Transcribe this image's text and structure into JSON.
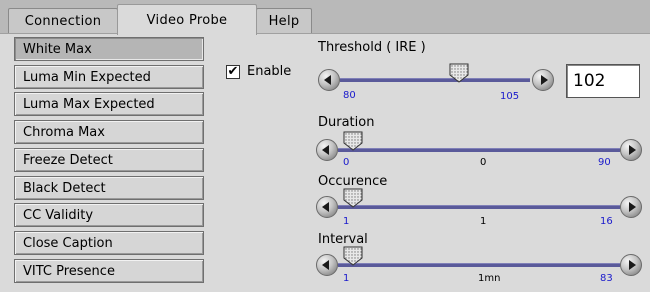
{
  "tabs": [
    {
      "label": "Connection",
      "active": false
    },
    {
      "label": "Video Probe",
      "active": true
    },
    {
      "label": "Help",
      "active": false
    }
  ],
  "probe_list": [
    {
      "label": "White Max",
      "selected": true
    },
    {
      "label": "Luma Min Expected",
      "selected": false
    },
    {
      "label": "Luma Max Expected",
      "selected": false
    },
    {
      "label": "Chroma Max",
      "selected": false
    },
    {
      "label": "Freeze Detect",
      "selected": false
    },
    {
      "label": "Black Detect",
      "selected": false
    },
    {
      "label": "CC Validity",
      "selected": false
    },
    {
      "label": "Close Caption",
      "selected": false
    },
    {
      "label": "VITC Presence",
      "selected": false
    }
  ],
  "enable": {
    "label": "Enable",
    "checked": true,
    "mark": "✔"
  },
  "threshold": {
    "label": "Threshold ( IRE )",
    "min_label": "80",
    "current_label": "105",
    "input_value": "102",
    "fraction": 0.62
  },
  "duration": {
    "label": "Duration",
    "min_label": "0",
    "mid_label": "0",
    "max_label": "90",
    "fraction": 0.0
  },
  "occurence": {
    "label": "Occurence",
    "min_label": "1",
    "mid_label": "1",
    "max_label": "16",
    "fraction": 0.0
  },
  "interval": {
    "label": "Interval",
    "min_label": "1",
    "mid_label": "1mn",
    "max_label": "83",
    "fraction": 0.0
  },
  "colors": {
    "track": "#5a5a9a",
    "tick_blue": "#1a1acc",
    "selected_item": "#b5b5b5"
  }
}
